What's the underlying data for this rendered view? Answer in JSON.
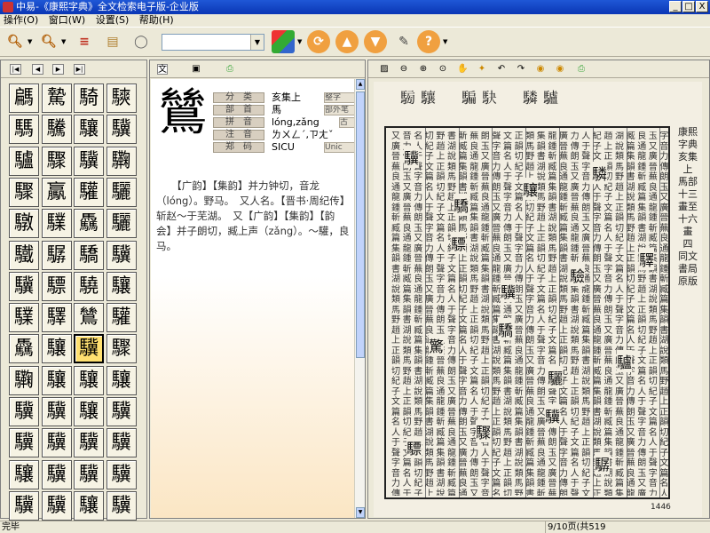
{
  "window": {
    "title": "中易-《康熙字典》全文检索电子版-企业版",
    "min": "_",
    "max": "□",
    "close": "X"
  },
  "menu": [
    "操作(O)",
    "窗口(W)",
    "设置(S)",
    "帮助(H)"
  ],
  "toolbar": {
    "search_value": "",
    "drop": "▼"
  },
  "left_nav": [
    "|◀",
    "◀",
    "▶",
    "▶|"
  ],
  "chars": [
    "騗",
    "騺",
    "騎",
    "騻",
    "騳",
    "驣",
    "驤",
    "驥",
    "驢",
    "驟",
    "驥",
    "驧",
    "驟",
    "驘",
    "驩",
    "驪",
    "驐",
    "驜",
    "驫",
    "驪",
    "驖",
    "驏",
    "驕",
    "驥",
    "驥",
    "驃",
    "驍",
    "驤",
    "驜",
    "驛",
    "鷥",
    "驩",
    "驫",
    "驤",
    "驥",
    "驟",
    "驧",
    "驤",
    "驤",
    "驤",
    "驥",
    "驥",
    "驤",
    "驥",
    "驥",
    "驥",
    "驥",
    "驥",
    "驤",
    "驥",
    "驥",
    "驥",
    "驥",
    "驥",
    "驤",
    "驥"
  ],
  "selected_index": 34,
  "entry": {
    "char": "鷥",
    "rows": [
      {
        "label": "分　类",
        "value": "亥集上",
        "tag": "整字"
      },
      {
        "label": "部　首",
        "value": "馬",
        "tag": "部外笔"
      },
      {
        "label": "拼　音",
        "value": "lóng,zǎng",
        "tag": "古"
      },
      {
        "label": "注　音",
        "value": "ㄌㄨㄥˊ,ㄗㄤˇ",
        "tag": "Unic"
      },
      {
        "label": "郑　码",
        "value": "SICU",
        "tag": "Unic"
      }
    ],
    "definition": "　　【广韵】【集韵】并力钟切，音龙（lóng）。野马。　又人名。【晋书·周纪传】斩赵～于芜湖。　又【广韵】【集韵】【韵会】并子朗切，臧上声（zǎng）。～驩，良马。"
  },
  "page": {
    "header": "𩤐驤　騙駃　驎驢",
    "side": "康熙字典　亥集上　馬部　十三畫至十六畫　四　同文書局原版",
    "page_number": "1446",
    "head_chars": [
      "驥",
      "驃",
      "驕",
      "驥",
      "驎",
      "驛",
      "驚",
      "驟",
      "驤",
      "驗",
      "驢",
      "驃",
      "驕",
      "驥",
      "驪",
      "驏"
    ]
  },
  "status": {
    "left": "完毕",
    "right": "9/10页(共519个)"
  }
}
